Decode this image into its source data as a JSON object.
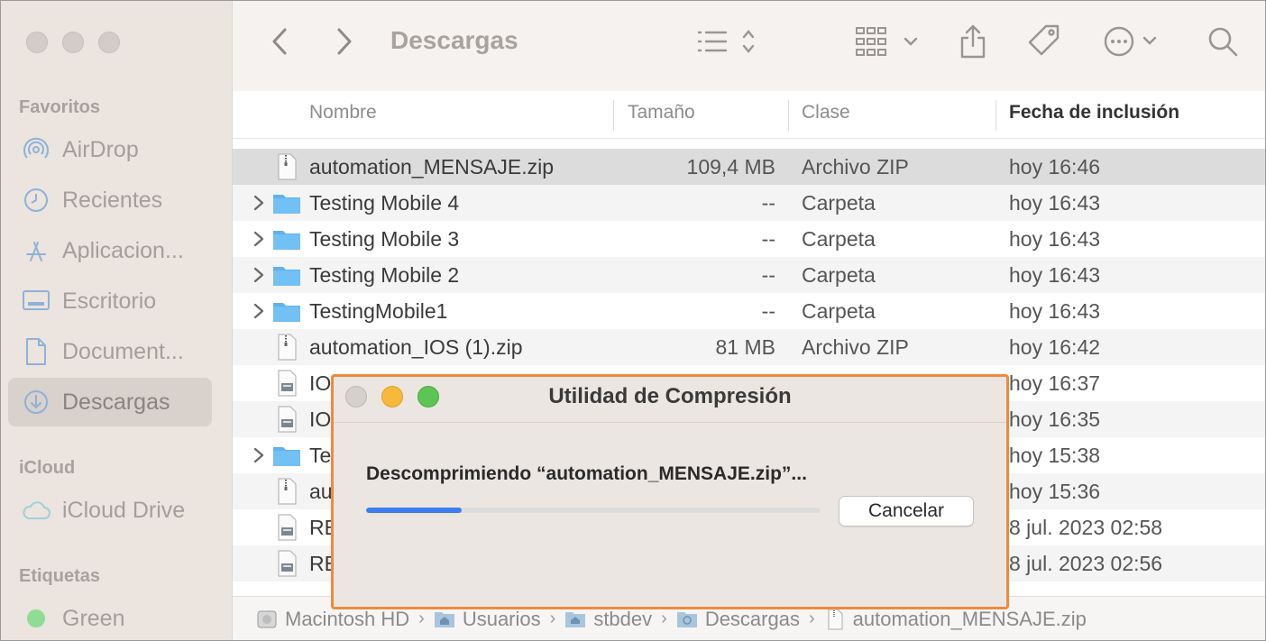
{
  "sidebar": {
    "favorites_heading": "Favoritos",
    "favorites": [
      {
        "label": "AirDrop",
        "icon": "airdrop-icon"
      },
      {
        "label": "Recientes",
        "icon": "clock-icon"
      },
      {
        "label": "Aplicacion...",
        "icon": "applications-icon"
      },
      {
        "label": "Escritorio",
        "icon": "desktop-icon"
      },
      {
        "label": "Document...",
        "icon": "document-icon"
      },
      {
        "label": "Descargas",
        "icon": "downloads-icon",
        "selected": true
      }
    ],
    "icloud_heading": "iCloud",
    "icloud": [
      {
        "label": "iCloud Drive",
        "icon": "cloud-icon"
      }
    ],
    "tags_heading": "Etiquetas",
    "tags": [
      {
        "label": "Green",
        "icon": "green-tag-icon",
        "color": "#5dc662"
      }
    ]
  },
  "toolbar": {
    "title": "Descargas",
    "back_icon": "chevron-left-icon",
    "forward_icon": "chevron-right-icon",
    "view_icon": "list-view-icon",
    "group_icon": "grid-group-icon",
    "share_icon": "share-icon",
    "tag_icon": "tag-icon",
    "more_icon": "more-icon",
    "search_icon": "search-icon"
  },
  "columns": {
    "name": "Nombre",
    "size": "Tamaño",
    "kind": "Clase",
    "date": "Fecha de inclusión"
  },
  "rows": [
    {
      "name": "automation_MENSAJE.zip",
      "size": "109,4 MB",
      "kind": "Archivo ZIP",
      "date": "hoy 16:46",
      "type": "zip",
      "expand": false,
      "selected": true
    },
    {
      "name": "Testing Mobile 4",
      "size": "--",
      "kind": "Carpeta",
      "date": "hoy 16:43",
      "type": "folder",
      "expand": true
    },
    {
      "name": "Testing Mobile 3",
      "size": "--",
      "kind": "Carpeta",
      "date": "hoy 16:43",
      "type": "folder",
      "expand": true
    },
    {
      "name": "Testing Mobile 2",
      "size": "--",
      "kind": "Carpeta",
      "date": "hoy 16:43",
      "type": "folder",
      "expand": true
    },
    {
      "name": "TestingMobile1",
      "size": "--",
      "kind": "Carpeta",
      "date": "hoy 16:43",
      "type": "folder",
      "expand": true
    },
    {
      "name": "automation_IOS (1).zip",
      "size": "81 MB",
      "kind": "Archivo ZIP",
      "date": "hoy 16:42",
      "type": "zip",
      "expand": false
    },
    {
      "name": "IO",
      "size": "",
      "kind": "",
      "date": "hoy 16:37",
      "type": "doc",
      "expand": false
    },
    {
      "name": "IO",
      "size": "",
      "kind": "",
      "date": "hoy 16:35",
      "type": "doc",
      "expand": false
    },
    {
      "name": "Te",
      "size": "",
      "kind": "",
      "date": "hoy 15:38",
      "type": "folder",
      "expand": true
    },
    {
      "name": "au",
      "size": "",
      "kind": "",
      "date": "hoy 15:36",
      "type": "zip",
      "expand": false
    },
    {
      "name": "RE",
      "size": "",
      "kind": "",
      "date": "8 jul. 2023 02:58",
      "type": "doc",
      "expand": false
    },
    {
      "name": "RE",
      "size": "",
      "kind": "",
      "date": "8 jul. 2023 02:56",
      "type": "doc",
      "expand": false
    }
  ],
  "pathbar": [
    {
      "label": "Macintosh HD",
      "icon": "hard-drive-icon"
    },
    {
      "label": "Usuarios",
      "icon": "folder-home-icon"
    },
    {
      "label": "stbdev",
      "icon": "home-icon"
    },
    {
      "label": "Descargas",
      "icon": "folder-downloads-icon"
    },
    {
      "label": "automation_MENSAJE.zip",
      "icon": "zip-icon"
    }
  ],
  "dialog": {
    "title": "Utilidad de Compresión",
    "message": "Descomprimiendo “automation_MENSAJE.zip”...",
    "progress": 0.21,
    "cancel_label": "Cancelar",
    "accent_color": "#3d7ef0"
  }
}
